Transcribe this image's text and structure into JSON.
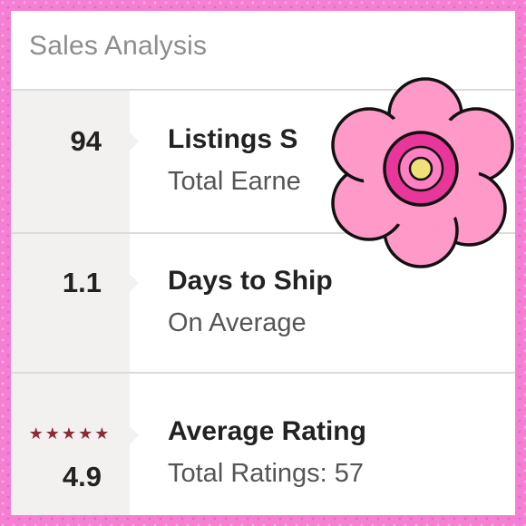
{
  "header": {
    "title": "Sales Analysis"
  },
  "stats": [
    {
      "value": "94",
      "title": "Listings S",
      "subtitle": "Total Earne"
    },
    {
      "value": "1.1",
      "title": "Days to Ship",
      "subtitle": "On Average"
    },
    {
      "value": "4.9",
      "stars": "★★★★★",
      "title": "Average Rating",
      "subtitle": "Total Ratings: 57"
    }
  ],
  "rating": {
    "stars_out_of_5": 5
  },
  "colors": {
    "frame": "#f47fd3",
    "star": "#8c2a36",
    "flower_petals": "#ff99c8",
    "flower_center": "#e8369b",
    "flower_core": "#f0e07a"
  },
  "decor": {
    "sticker": "flower-sticker"
  }
}
